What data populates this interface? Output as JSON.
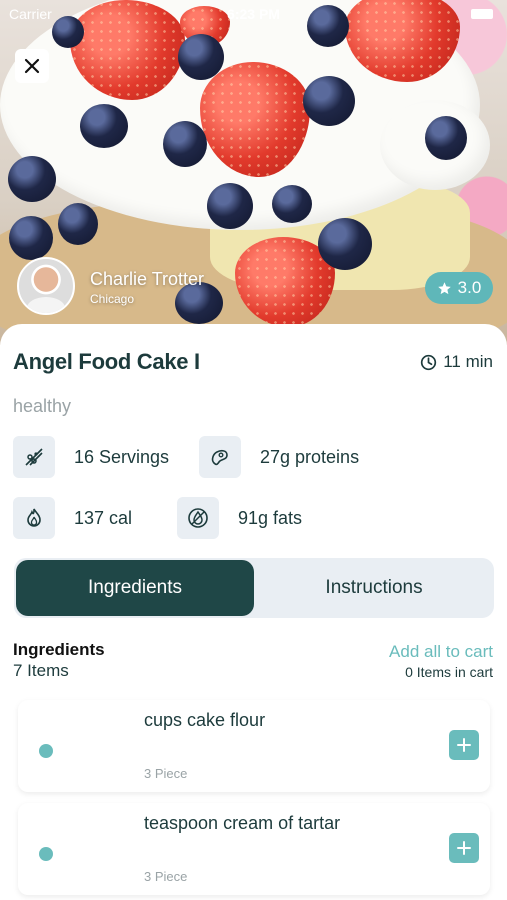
{
  "status_bar": {
    "carrier": "Carrier",
    "time": "6:23 PM"
  },
  "hero": {
    "close_icon": "close-icon"
  },
  "chef": {
    "name": "Charlie Trotter",
    "location": "Chicago"
  },
  "rating": {
    "value": "3.0",
    "icon": "star-icon"
  },
  "recipe": {
    "title": "Angel Food Cake I",
    "time": "11 min",
    "tag": "healthy"
  },
  "stats": [
    {
      "icon": "servings-icon",
      "label": "16 Servings"
    },
    {
      "icon": "protein-icon",
      "label": "27g proteins"
    },
    {
      "icon": "calories-icon",
      "label": "137 cal"
    },
    {
      "icon": "fat-icon",
      "label": "91g fats"
    }
  ],
  "tabs": [
    {
      "label": "Ingredients",
      "active": true
    },
    {
      "label": "Instructions",
      "active": false
    }
  ],
  "ingredients": {
    "heading": "Ingredients",
    "count": "7 Items",
    "add_all": "Add all to cart",
    "in_cart": "0 Items in cart",
    "items": [
      {
        "name": "cups cake flour",
        "qty": "3 Piece"
      },
      {
        "name": "teaspoon cream of tartar",
        "qty": "3 Piece"
      }
    ]
  },
  "colors": {
    "accent": "#6abcbc",
    "dark_teal": "#1f4747",
    "text": "#1d3b3c",
    "muted": "#9aa3a6",
    "chip_bg": "#e9eef3"
  }
}
